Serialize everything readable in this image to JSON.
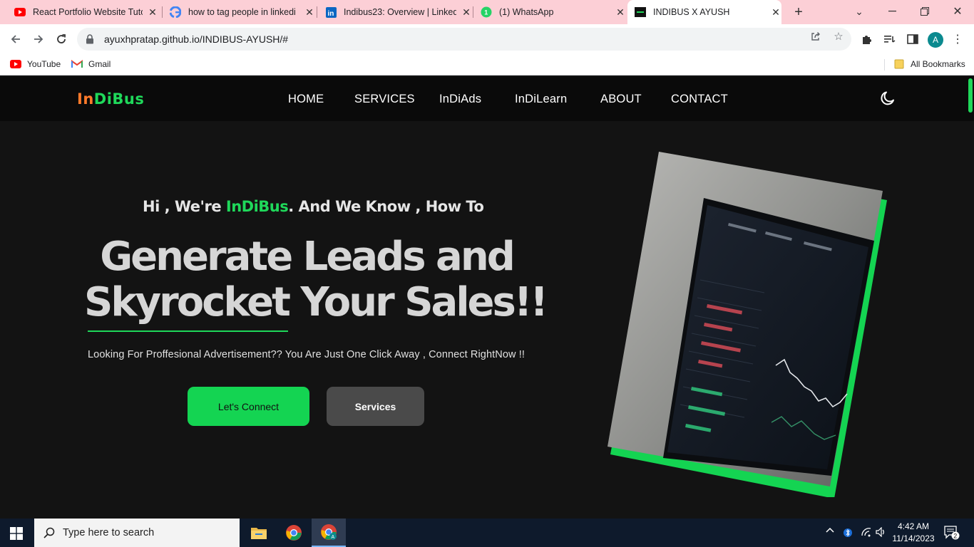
{
  "browser": {
    "tabs": [
      {
        "title": "React Portfolio Website Tuto",
        "icon": "youtube-icon"
      },
      {
        "title": "how to tag people in linkedi",
        "icon": "google-icon"
      },
      {
        "title": "Indibus23: Overview | Linked",
        "icon": "linkedin-icon"
      },
      {
        "title": "(1) WhatsApp",
        "icon": "whatsapp-icon",
        "badge": "1"
      },
      {
        "title": "INDIBUS X AYUSH",
        "icon": "indibus-favicon",
        "active": true
      }
    ],
    "url": "ayuxhpratap.github.io/INDIBUS-AYUSH/#",
    "bookmarks": [
      {
        "label": "YouTube",
        "icon": "youtube-icon"
      },
      {
        "label": "Gmail",
        "icon": "gmail-icon"
      }
    ],
    "all_bookmarks_label": "All Bookmarks",
    "profile_initial": "A"
  },
  "site": {
    "logo_part1": "In",
    "logo_part2": "Di",
    "logo_part3": "Bus",
    "nav": [
      "HOME",
      "SERVICES",
      "InDiAds",
      "InDiLearn",
      "ABOUT",
      "CONTACT"
    ],
    "intro_prefix": "Hi , We're ",
    "intro_brand": "InDiBus",
    "intro_suffix": ". And We Know , How To",
    "headline_line1": "Generate Leads and",
    "headline_line2": "Skyrocket Your Sales!!",
    "subtitle": "Looking For Proffesional Advertisement?? You Are Just One Click Away , Connect RightNow !!",
    "cta_primary": "Let's Connect",
    "cta_secondary": "Services",
    "colors": {
      "accent": "#1fd85a",
      "logo_orange": "#ff7a2a",
      "background": "#131313"
    }
  },
  "taskbar": {
    "search_placeholder": "Type here to search",
    "time": "4:42 AM",
    "date": "11/14/2023",
    "notification_count": "2"
  }
}
